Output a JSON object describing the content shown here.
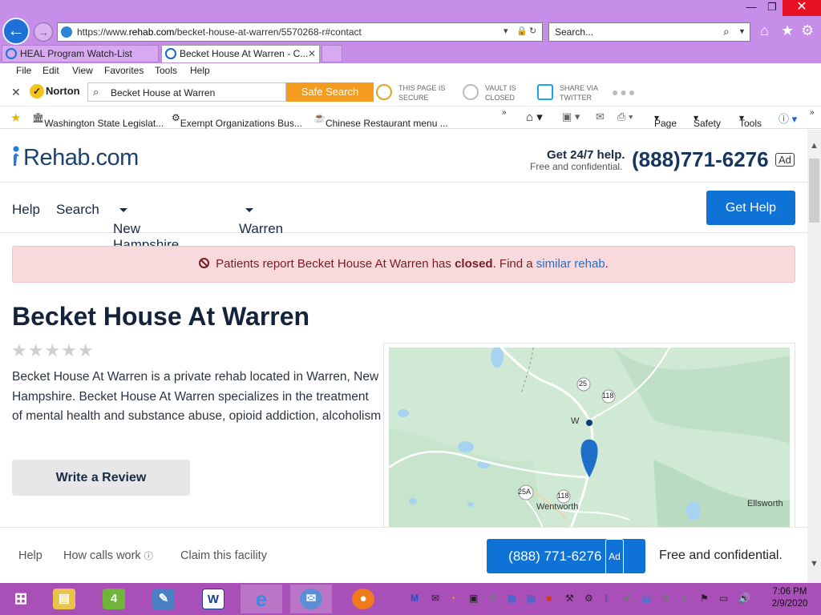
{
  "window": {
    "minimize": "—",
    "maximize": "❐",
    "close": "✕"
  },
  "addressbar": {
    "url_prefix": "https://www.",
    "url_domain": "rehab.com",
    "url_path": "/becket-house-at-warren/5570268-r#contact"
  },
  "searchbar": {
    "placeholder": "Search..."
  },
  "tabs": [
    {
      "label": "HEAL Program Watch-List"
    },
    {
      "label": "Becket House At Warren - C...",
      "close": "✕"
    }
  ],
  "menu": [
    "File",
    "Edit",
    "View",
    "Favorites",
    "Tools",
    "Help"
  ],
  "norton": {
    "brand": "Norton",
    "search_value": "Becket House at Warren",
    "safe_search": "Safe Search",
    "items": [
      {
        "line1": "THIS PAGE IS",
        "line2": "SECURE"
      },
      {
        "line1": "VAULT IS",
        "line2": "CLOSED"
      },
      {
        "line1": "SHARE VIA",
        "line2": "TWITTER"
      }
    ]
  },
  "favorites": {
    "items": [
      "Washington State Legislat...",
      "Exempt Organizations Bus...",
      "Chinese Restaurant menu ..."
    ],
    "commands": [
      "Page",
      "Safety",
      "Tools"
    ]
  },
  "site": {
    "logo": "Rehab.com",
    "help_247": "Get 24/7 help.",
    "free_confidential": "Free and confidential.",
    "phone": "(888)771-6276",
    "ad": "Ad",
    "nav": {
      "help": "Help",
      "search": "Search",
      "state": "New Hampshire",
      "city": "Warren",
      "get_help": "Get Help"
    },
    "alert": {
      "prefix": "Patients report Becket House At Warren has ",
      "strong": "closed",
      "middle": ". Find a ",
      "link": "similar rehab",
      "suffix": "."
    },
    "facility": {
      "name": "Becket House At Warren",
      "stars": "★★★★★",
      "description": "Becket House At Warren is a private rehab located in Warren, New Hampshire. Becket House At Warren specializes in the treatment of mental health and substance abuse, opioid addiction, alcoholism",
      "write_review": "Write a Review"
    },
    "map": {
      "labels": {
        "r25": "25",
        "r118a": "118",
        "r25a": "25A",
        "r118b": "118",
        "wentworth": "Wentworth",
        "ellsworth": "Ellsworth",
        "w": "W"
      }
    },
    "bottom": {
      "help": "Help",
      "how_calls": "How calls work",
      "claim": "Claim this facility",
      "phone": "(888) 771-6276",
      "free": "Free and confidential."
    }
  },
  "taskbar": {
    "time": "7:06 PM",
    "date": "2/9/2020"
  },
  "colors": {
    "chrome": "#c68de9",
    "taskbar": "#a84fb8",
    "brand_blue": "#0f72d6",
    "alert_bg": "#f8dadc",
    "norton_orange": "#f39c1f"
  }
}
